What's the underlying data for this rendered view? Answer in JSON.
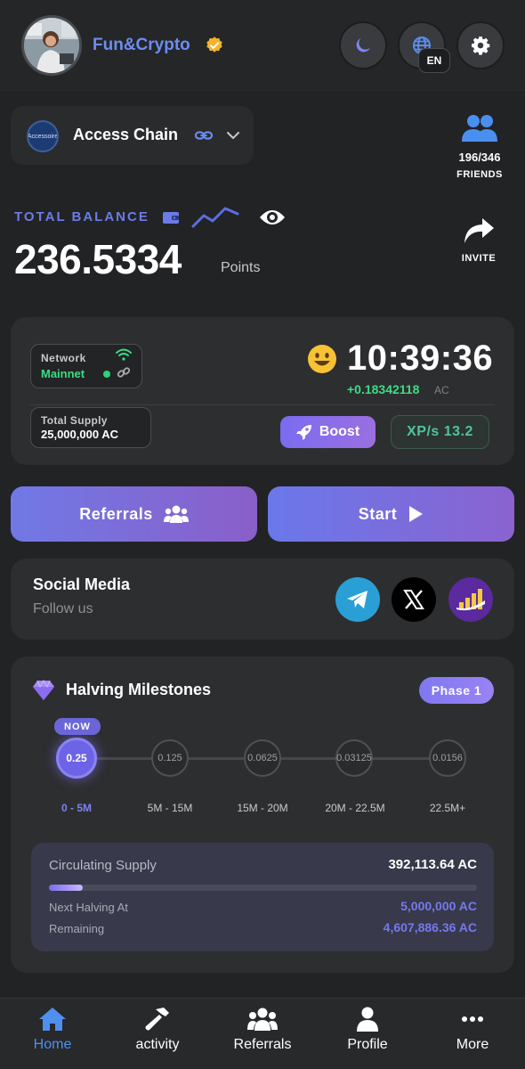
{
  "header": {
    "username": "Fun&Crypto",
    "language": "EN"
  },
  "chain": {
    "logo_text": "Accessoire",
    "name": "Access Chain"
  },
  "friends": {
    "count": "196/346",
    "label": "FRIENDS"
  },
  "balance": {
    "label": "TOTAL BALANCE",
    "value": "236.5334",
    "unit": "Points"
  },
  "invite": {
    "label": "INVITE"
  },
  "mining": {
    "network_label": "Network",
    "network_value": "Mainnet",
    "timer": "10:39:36",
    "rate": "+0.18342118",
    "rate_unit": "AC",
    "supply_label": "Total Supply",
    "supply_value": "25,000,000 AC",
    "boost_label": "Boost",
    "xp_label": "XP/s 13.2"
  },
  "actions": {
    "referrals_label": "Referrals",
    "start_label": "Start"
  },
  "social": {
    "title": "Social Media",
    "subtitle": "Follow us"
  },
  "halving": {
    "title": "Halving Milestones",
    "phase": "Phase 1",
    "now_label": "NOW",
    "milestones": [
      {
        "rate": "0.25",
        "range": "0 - 5M"
      },
      {
        "rate": "0.125",
        "range": "5M - 15M"
      },
      {
        "rate": "0.0625",
        "range": "15M - 20M"
      },
      {
        "rate": "0.03125",
        "range": "20M - 22.5M"
      },
      {
        "rate": "0.0156",
        "range": "22.5M+"
      }
    ],
    "circulating_label": "Circulating Supply",
    "circulating_value": "392,113.64 AC",
    "progress_fraction": 0.078,
    "next_halving_label": "Next Halving At",
    "next_halving_value": "5,000,000 AC",
    "remaining_label": "Remaining",
    "remaining_value": "4,607,886.36 AC"
  },
  "nav": {
    "items": [
      {
        "label": "Home",
        "icon": "home-icon"
      },
      {
        "label": "activity",
        "icon": "hammer-icon"
      },
      {
        "label": "Referrals",
        "icon": "users-icon"
      },
      {
        "label": "Profile",
        "icon": "user-icon"
      },
      {
        "label": "More",
        "icon": "more-icon"
      }
    ]
  },
  "colors": {
    "accent": "#6b7ce8",
    "green": "#3ddc84",
    "nav_active": "#4f8ff0",
    "background": "#222325",
    "card": "#2d2e30"
  }
}
